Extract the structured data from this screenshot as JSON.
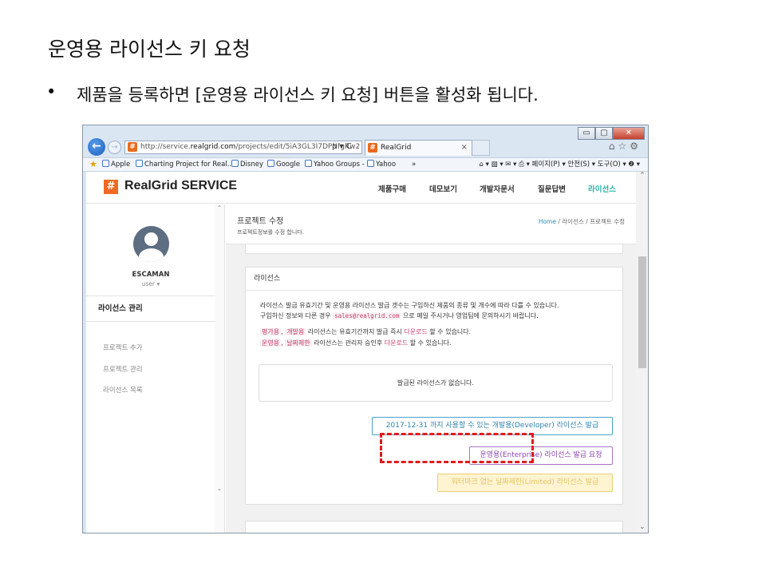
{
  "slide": {
    "title": "운영용 라이선스 키 요청",
    "bullet_mark": "•",
    "bullet_text": "제품을 등록하면 [운영용 라이선스 키 요청] 버튼을 활성화 됩니다."
  },
  "browser": {
    "window_controls": {
      "minimize": "▭",
      "maximize": "▢",
      "close": "✕"
    },
    "back_glyph": "←",
    "forward_glyph": "→",
    "address_prefix": "http://service.",
    "address_domain": "realgrid.com",
    "address_suffix": "/projects/edit/5iA3GL3I7DPNfgRw2",
    "address_tools": "ρ ▾ C",
    "tab_title": "RealGrid",
    "tab_close": "×",
    "toolbar_icons": "⌂☆⚙",
    "favorites": [
      "Apple",
      "Charting Project for Real...",
      "Disney",
      "Google",
      "Yahoo Groups -",
      "Yahoo"
    ],
    "favorites_overflow": "»",
    "command_bar": "⌂ ▾ ▧ ▾ ✉ ▾ ⎙ ▾  페이지(P) ▾  안전(S) ▾  도구(O) ▾  ❷ ▾"
  },
  "site": {
    "logo_mark": "#",
    "logo_text": "RealGrid SERVICE",
    "nav": [
      "제품구매",
      "데모보기",
      "개발자문서",
      "질문답변",
      "라이선스"
    ],
    "nav_active_index": 4
  },
  "sidebar": {
    "username": "ESCAMAN",
    "role": "user ▾",
    "section": "라이선스 관리",
    "items": [
      "프로젝트 추가",
      "프로젝트 관리",
      "라이선스 목록"
    ]
  },
  "content": {
    "title": "프로젝트 수정",
    "subtitle": "프로젝트정보를 수정 합니다.",
    "breadcrumb": {
      "home": "Home",
      "sep": "/",
      "l2": "라이선스",
      "l3": "프로젝트 수정"
    },
    "card_title": "라이선스",
    "desc_line1": "라이선스 발급 유효기간 및 운영용 라이선스 발급 갯수는 구입하신 제품의 종류 및 개수에 따라 다를 수 있습니다.",
    "desc_line2_a": "구입하신 정보와 다른 경우",
    "desc_email": "sales@realgrid.com",
    "desc_line2_b": "으로 메일 주시거나 영업팀에 문의하시기 바랍니다.",
    "line3": {
      "tag1": "평가용",
      "sep": ",",
      "tag2": "개발용",
      "mid": "라이선스는 유효기간까지 발급 즉시",
      "dl": "다운로드",
      "end": "할 수 있습니다."
    },
    "line4": {
      "tag1": "운영용",
      "sep": ",",
      "tag2": "날짜제한",
      "mid": "라이선스는 관리자 승인후",
      "dl": "다운로드",
      "end": "할 수 있습니다."
    },
    "empty_message": "발급된 라이선스가 없습니다.",
    "btn_developer": "2017-12-31 까지 사용할 수 있는 개발용(Developer) 라이선스 발급",
    "btn_enterprise": "운영용(Enterprise) 라이선스 발급 요청",
    "btn_limited": "워터마크 없는 날짜제한(Limited) 라이선스 발급"
  },
  "colors": {
    "accent": "#2bb3a5",
    "logo": "#ef6a22",
    "highlight": "#e01b1b",
    "enterprise": "#8d45b0",
    "developer": "#2f86ad"
  }
}
